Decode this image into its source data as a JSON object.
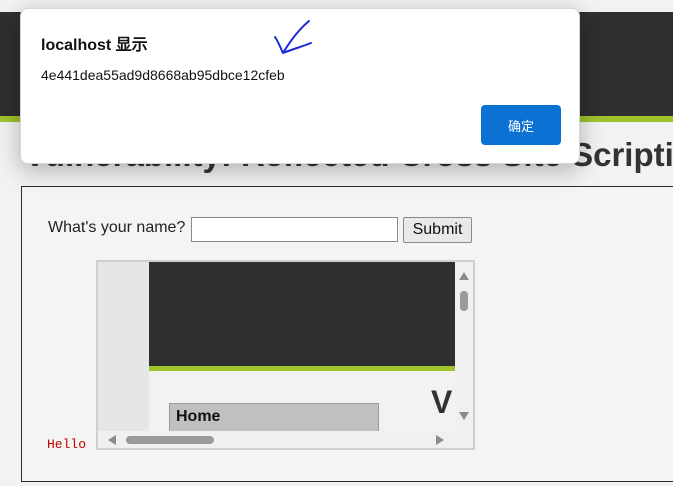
{
  "dialog": {
    "title": "localhost 显示",
    "message": "4e441dea55ad9d8668ab95dbce12cfeb",
    "ok_label": "确定"
  },
  "page": {
    "title": "Vulnerability: Reflected Cross Site Scripting (XSS)",
    "form": {
      "label": "What's your name?",
      "input_value": "",
      "submit_label": "Submit"
    },
    "output": {
      "hello_text": "Hello"
    },
    "iframe": {
      "nav_item": "Home",
      "title_fragment": "V"
    }
  },
  "colors": {
    "header_dark": "#2f2f2f",
    "accent_green": "#9dc42d",
    "button_blue": "#0b72d4",
    "hello_red": "#c00000",
    "annotation_blue": "#1a2bd6"
  }
}
